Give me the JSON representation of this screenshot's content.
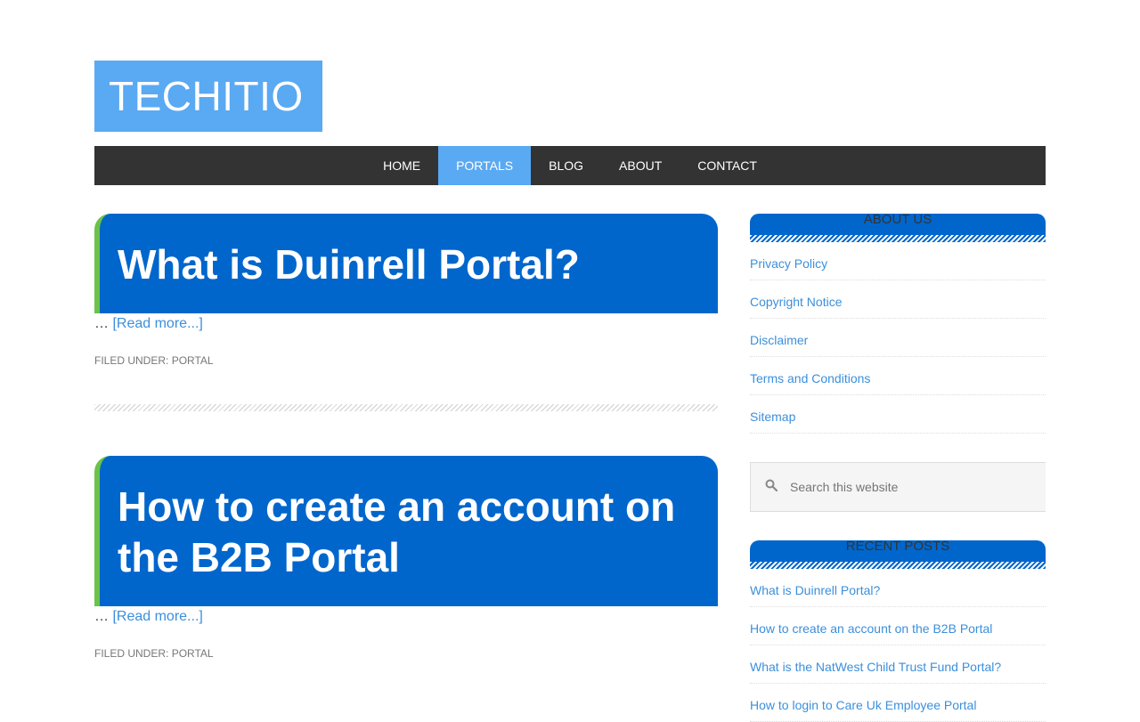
{
  "site": {
    "title": "TECHITIO"
  },
  "nav": {
    "items": [
      "HOME",
      "PORTALS",
      "BLOG",
      "ABOUT",
      "CONTACT"
    ],
    "active": "PORTALS"
  },
  "posts": [
    {
      "title": "What is Duinrell Portal?",
      "excerpt_prefix": "… ",
      "read_more": "[Read more...]",
      "filed_under_label": "FILED UNDER: ",
      "category": "PORTAL"
    },
    {
      "title": "How to create an account on the B2B Portal",
      "excerpt_prefix": "… ",
      "read_more": "[Read more...]",
      "filed_under_label": "FILED UNDER: ",
      "category": "PORTAL"
    }
  ],
  "sidebar": {
    "about": {
      "title": "ABOUT US",
      "links": [
        "Privacy Policy",
        "Copyright Notice",
        "Disclaimer",
        "Terms and Conditions",
        "Sitemap"
      ]
    },
    "search": {
      "placeholder": "Search this website"
    },
    "recent": {
      "title": "RECENT POSTS",
      "links": [
        "What is Duinrell Portal?",
        "How to create an account on the B2B Portal",
        "What is the NatWest Child Trust Fund Portal?",
        "How to login to Care Uk Employee Portal"
      ]
    }
  },
  "colors": {
    "accent": "#5aa9f3",
    "post_title_bg": "#0066cc",
    "post_title_border": "#6cc24a",
    "nav_bg": "#333333",
    "link": "#3b8fdc"
  }
}
